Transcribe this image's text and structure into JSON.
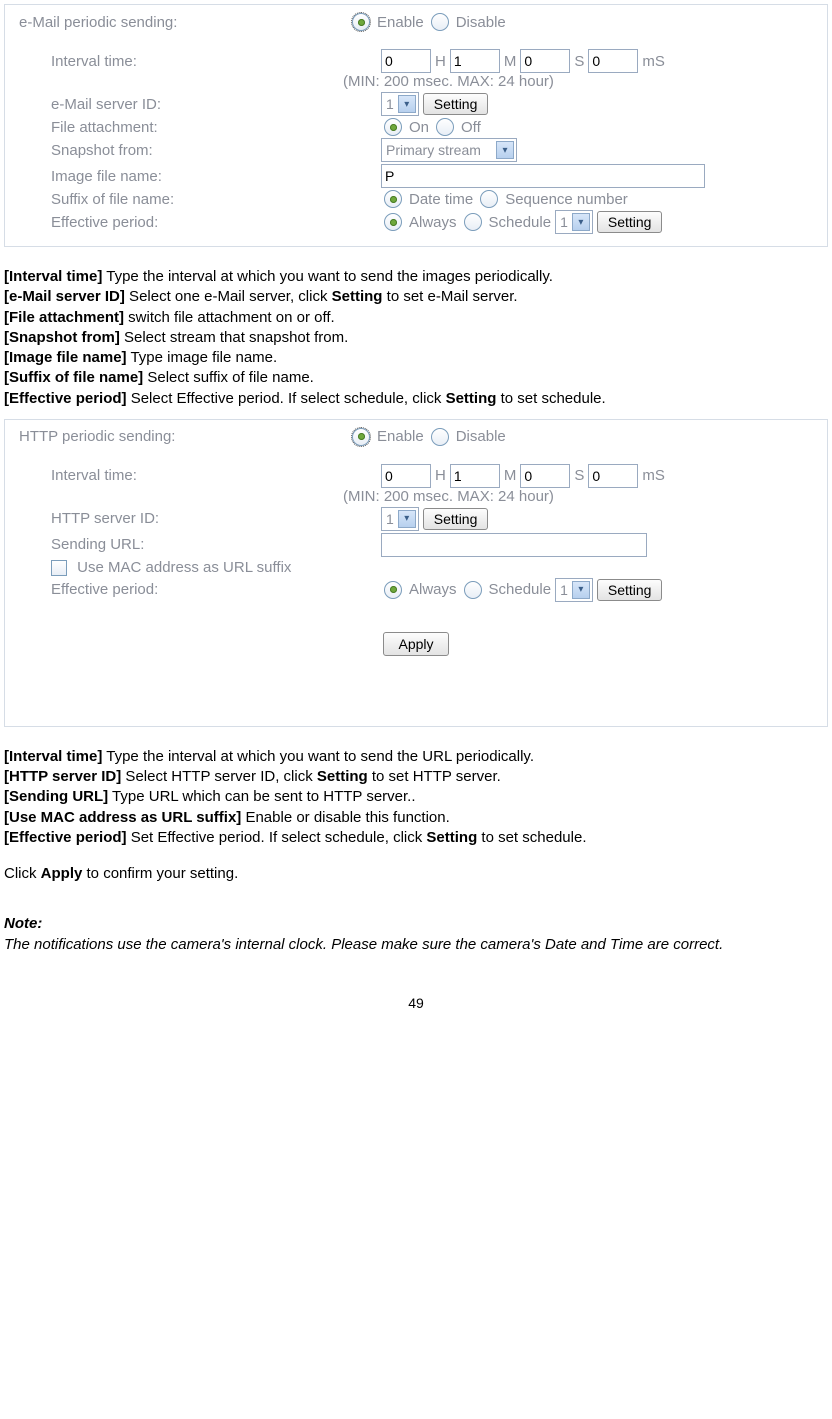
{
  "email": {
    "title": "e-Mail periodic sending:",
    "enable": "Enable",
    "disable": "Disable",
    "interval_label": "Interval time:",
    "H": "H",
    "M": "M",
    "S": "S",
    "mS": "mS",
    "h_val": "0",
    "m_val": "1",
    "s_val": "0",
    "ms_val": "0",
    "minmax": "(MIN: 200 msec. MAX: 24 hour)",
    "server_label": "e-Mail server ID:",
    "server_val": "1",
    "setting": "Setting",
    "attach_label": "File attachment:",
    "on": "On",
    "off": "Off",
    "snapshot_label": "Snapshot from:",
    "snapshot_val": "Primary stream",
    "imgname_label": "Image file name:",
    "imgname_val": "P",
    "suffix_label": "Suffix of file name:",
    "datetime": "Date time",
    "seqnum": "Sequence number",
    "effective_label": "Effective period:",
    "always": "Always",
    "schedule": "Schedule",
    "sched_val": "1"
  },
  "desc1": {
    "l1b": "[Interval time]",
    "l1": " Type the interval at which you want to send the images periodically.",
    "l2b": "[e-Mail server ID]",
    "l2a": " Select one e-Mail server, click ",
    "l2c": "Setting",
    "l2d": " to set e-Mail server.",
    "l3b": "[File attachment]",
    "l3": " switch file attachment on or off.",
    "l4b": "[Snapshot from]",
    "l4": " Select stream that snapshot from.",
    "l5b": "[Image file name]",
    "l5": " Type image file name.",
    "l6b": "[Suffix of file name]",
    "l6": " Select suffix of file name.",
    "l7b": "[Effective period]",
    "l7a": " Select Effective period. If select schedule, click ",
    "l7c": "Setting",
    "l7d": " to set schedule."
  },
  "http": {
    "title": "HTTP periodic sending:",
    "server_label": "HTTP server ID:",
    "url_label": "Sending URL:",
    "url_val": "",
    "mac": "Use MAC address as URL suffix"
  },
  "apply": "Apply",
  "desc2": {
    "l1b": "[Interval time]",
    "l1": " Type the interval at which you want to send the URL periodically.",
    "l2b": "[HTTP server ID]",
    "l2a": " Select HTTP server ID, click ",
    "l2c": "Setting",
    "l2d": " to set HTTP server.",
    "l3b": "[Sending URL]",
    "l3": " Type URL which can be sent to HTTP server..",
    "l4b": "[Use MAC address as URL suffix]",
    "l4": " Enable or disable this function.",
    "l5b": "[Effective period]",
    "l5a": " Set Effective period. If select schedule, click ",
    "l5c": "Setting",
    "l5d": " to set schedule.",
    "l6a": "Click ",
    "l6b": "Apply",
    "l6c": " to confirm your setting."
  },
  "note": {
    "title": "Note:",
    "text": "The notifications use the camera's internal clock. Please make sure the camera's Date and Time are correct."
  },
  "pagenum": "49"
}
